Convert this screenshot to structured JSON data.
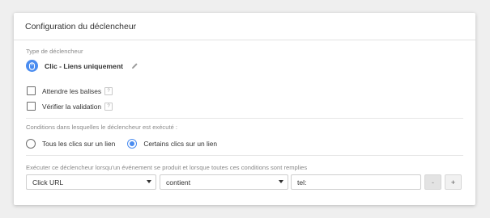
{
  "header": {
    "title": "Configuration du déclencheur"
  },
  "trigger_type": {
    "label": "Type de déclencheur",
    "value": "Clic - Liens uniquement",
    "icon": "mouse-click-icon",
    "edit_icon": "pencil-icon",
    "icon_color": "#4a8cf0"
  },
  "options": {
    "wait_tags_label": "Attendre les balises",
    "check_validation_label": "Vérifier la validation",
    "help_glyph": "?"
  },
  "conditions": {
    "label": "Conditions dans lesquelles le déclencheur est exécuté :",
    "all_clicks_label": "Tous les clics sur un lien",
    "some_clicks_label": "Certains clics sur un lien",
    "selected": "some_clicks"
  },
  "filter": {
    "label": "Exécuter ce déclencheur lorsqu'un événement se produit et lorsque toutes ces conditions sont remplies",
    "variable": "Click URL",
    "operator": "contient",
    "value": "tel:",
    "minus_label": "-",
    "plus_label": "+"
  }
}
